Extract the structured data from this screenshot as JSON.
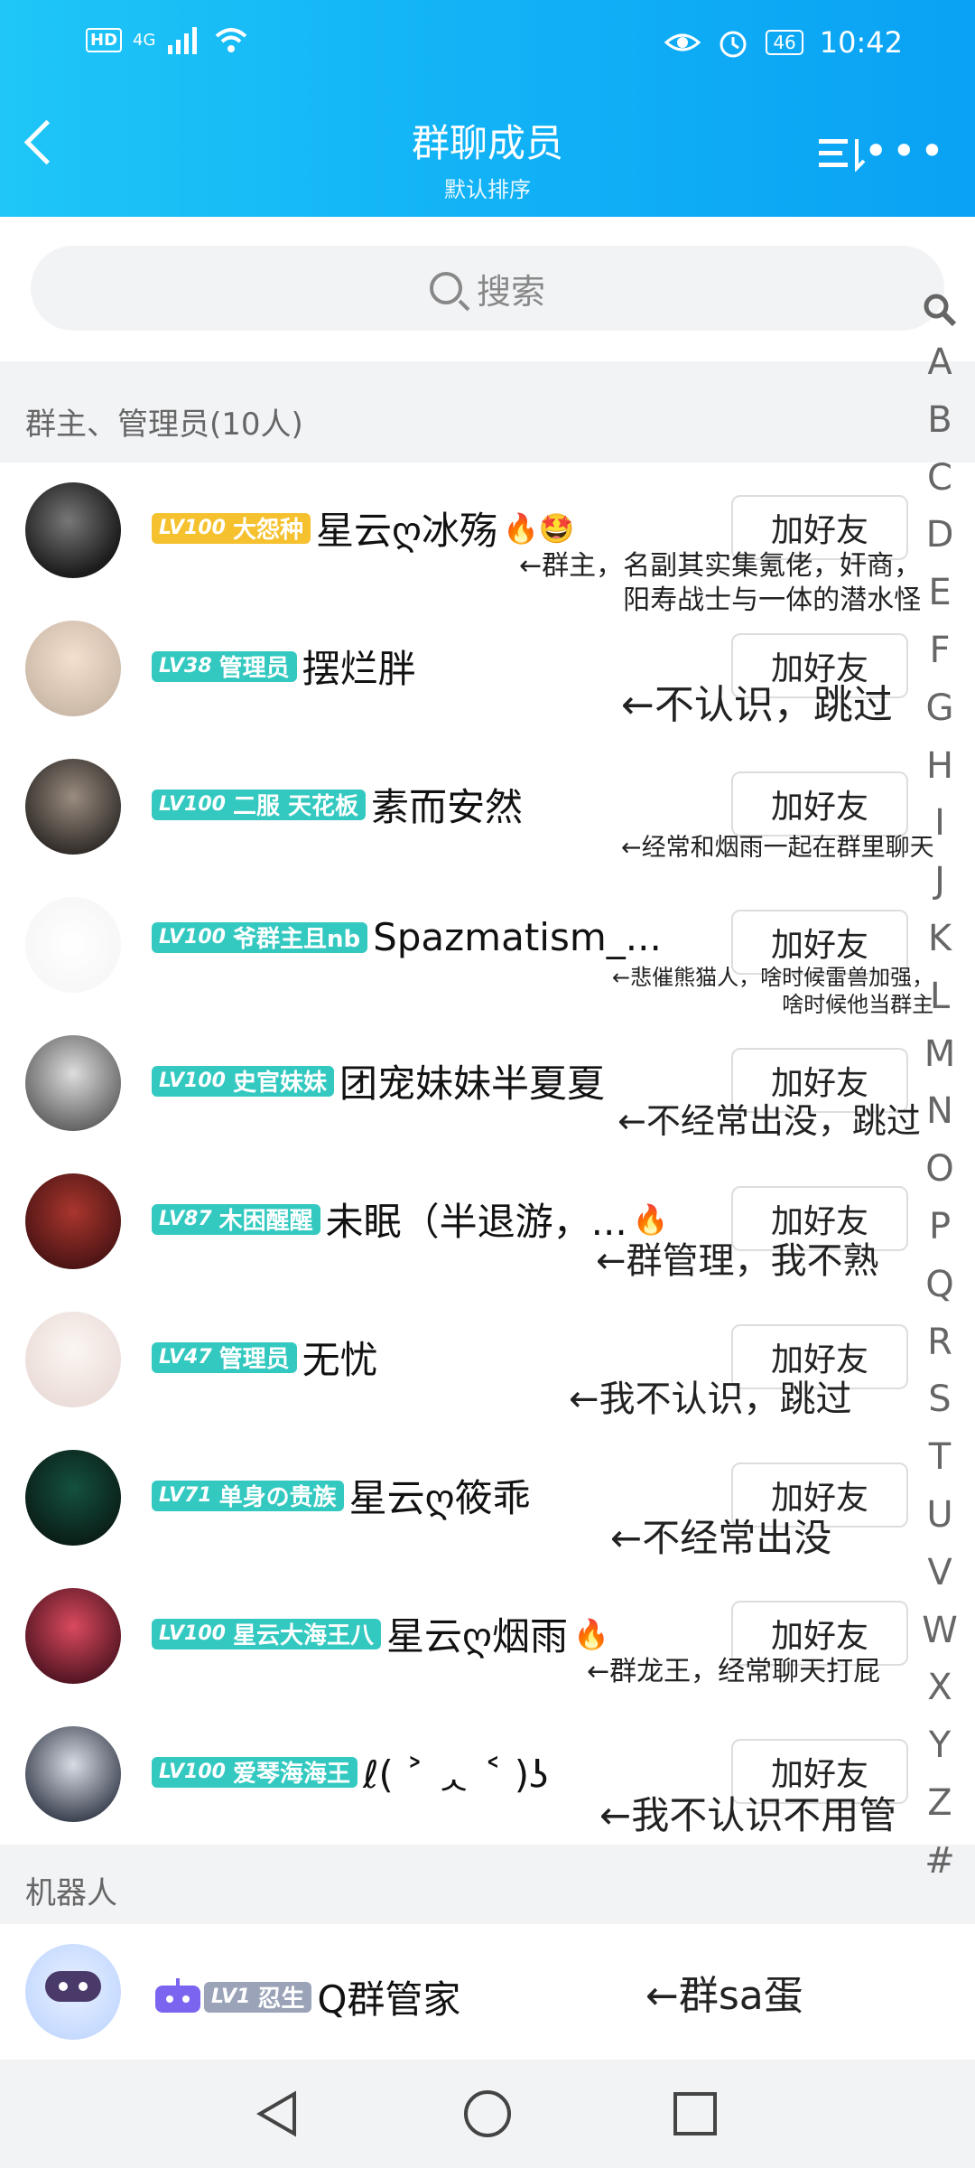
{
  "status_bar": {
    "network": "4G",
    "hd": "HD",
    "battery": "46",
    "time": "10:42"
  },
  "header": {
    "title": "群聊成员",
    "subtitle": "默认排序"
  },
  "search": {
    "placeholder": "搜索"
  },
  "admins_section": {
    "label": "群主、管理员(10人)"
  },
  "members": [
    {
      "level": "LV100",
      "title": "大怨种",
      "badge_color": "#f5c12e",
      "name": "星云ღ冰殇",
      "emojis": "🔥🤩",
      "button": "加好友",
      "note": "←群主，名副其实集氪佬，奸商，\n阳寿战士与一体的潜水怪"
    },
    {
      "level": "LV38",
      "title": "管理员",
      "badge_color": "#33c9c0",
      "name": "摆烂胖",
      "emojis": "",
      "button": "加好友",
      "note": "←不认识，跳过"
    },
    {
      "level": "LV100",
      "title": "二服 天花板",
      "badge_color": "#33c9c0",
      "name": "素而安然",
      "emojis": "",
      "button": "加好友",
      "note": "←经常和烟雨一起在群里聊天"
    },
    {
      "level": "LV100",
      "title": "爷群主且nb",
      "badge_color": "#33c9c0",
      "name": "Spazmatism_...",
      "emojis": "",
      "button": "加好友",
      "note": "←悲催熊猫人，啥时候雷兽加强，\n啥时候他当群主"
    },
    {
      "level": "LV100",
      "title": "史官妹妹",
      "badge_color": "#33c9c0",
      "name": "团宠妹妹半夏夏",
      "emojis": "",
      "button": "加好友",
      "note": "←不经常出没，跳过"
    },
    {
      "level": "LV87",
      "title": "木困醒醒",
      "badge_color": "#33c9c0",
      "name": "未眠（半退游，...",
      "emojis": "🔥",
      "button": "加好友",
      "note": "←群管理，我不熟"
    },
    {
      "level": "LV47",
      "title": "管理员",
      "badge_color": "#33c9c0",
      "name": "无忧",
      "emojis": "",
      "button": "加好友",
      "note": "←我不认识，跳过"
    },
    {
      "level": "LV71",
      "title": "单身の贵族",
      "badge_color": "#33c9c0",
      "name": "星云ღ筱乖",
      "emojis": "",
      "button": "加好友",
      "note": "←不经常出没"
    },
    {
      "level": "LV100",
      "title": "星云大海王八",
      "badge_color": "#33c9c0",
      "name": "星云ღ烟雨",
      "emojis": "🔥",
      "button": "加好友",
      "note": "←群龙王，经常聊天打屁"
    },
    {
      "level": "LV100",
      "title": "爱琴海海王",
      "badge_color": "#33c9c0",
      "name": "ℓ( ˃ ᆺ ˂ )ʖ",
      "emojis": "",
      "button": "加好友",
      "note": "←我不认识不用管"
    }
  ],
  "bots_section": {
    "label": "机器人"
  },
  "bot": {
    "level": "LV1",
    "title": "忍生",
    "name": "Q群管家",
    "note": "←群sa蛋"
  },
  "alpha_index": [
    "A",
    "B",
    "C",
    "D",
    "E",
    "F",
    "G",
    "H",
    "I",
    "J",
    "K",
    "L",
    "M",
    "N",
    "O",
    "P",
    "Q",
    "R",
    "S",
    "T",
    "U",
    "V",
    "W",
    "X",
    "Y",
    "Z",
    "#"
  ],
  "nav": {
    "back": "back-icon",
    "home": "home-icon",
    "recent": "recent-icon"
  }
}
